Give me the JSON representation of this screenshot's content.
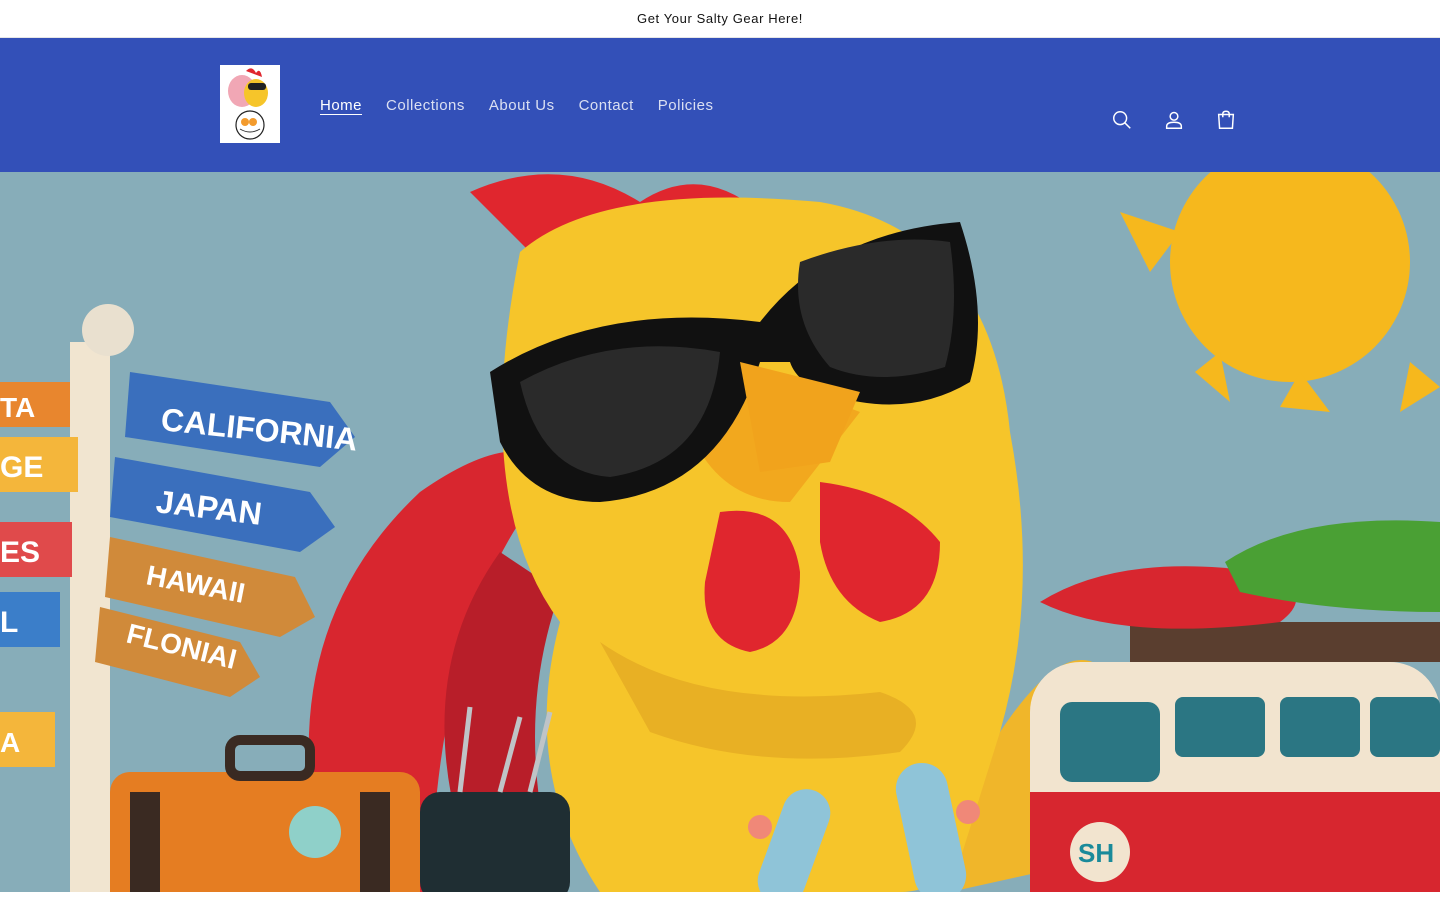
{
  "announcement": {
    "text": "Get Your Salty Gear Here!"
  },
  "header": {
    "logo_alt": "Salty Hooves logo",
    "nav": [
      {
        "label": "Home",
        "active": true
      },
      {
        "label": "Collections",
        "active": false
      },
      {
        "label": "About Us",
        "active": false
      },
      {
        "label": "Contact",
        "active": false
      },
      {
        "label": "Policies",
        "active": false
      }
    ],
    "icons": [
      "search-icon",
      "account-icon",
      "cart-icon"
    ]
  },
  "hero": {
    "signs": [
      "CALIFORNIA",
      "JAPAN",
      "HAWAII",
      "FLONIAI",
      "TA",
      "GE",
      "ES",
      "L",
      "A"
    ],
    "van_badge": "SH",
    "colors": {
      "sky": "#87adb9",
      "header": "#3350b8",
      "rooster": "#f6c52a",
      "comb": "#e0262e"
    }
  }
}
